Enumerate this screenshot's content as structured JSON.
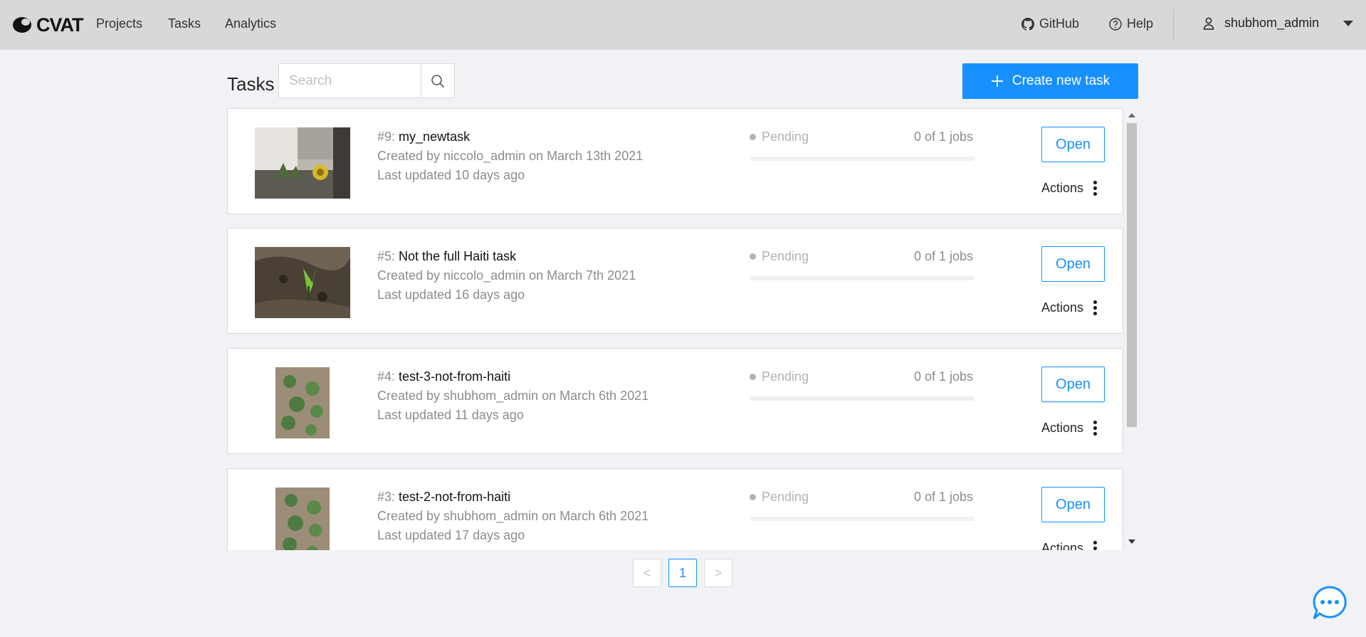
{
  "header": {
    "logo_text": "CVAT",
    "nav": [
      "Projects",
      "Tasks",
      "Analytics"
    ],
    "github_label": "GitHub",
    "help_label": "Help",
    "username": "shubhom_admin"
  },
  "toolbar": {
    "title": "Tasks",
    "search_placeholder": "Search",
    "create_label": "Create new task"
  },
  "tasks": [
    {
      "id": "#9:",
      "name": "my_newtask",
      "created": "Created by niccolo_admin on March 13th 2021",
      "updated": "Last updated 10 days ago",
      "status": "Pending",
      "jobs": "0 of 1 jobs",
      "progress": 0,
      "thumb": "wall-plant-photo",
      "open_label": "Open",
      "actions_label": "Actions"
    },
    {
      "id": "#5:",
      "name": "Not the full Haiti task",
      "created": "Created by niccolo_admin on March 7th 2021",
      "updated": "Last updated 16 days ago",
      "status": "Pending",
      "jobs": "0 of 1 jobs",
      "progress": 0,
      "thumb": "seedling-photo",
      "open_label": "Open",
      "actions_label": "Actions"
    },
    {
      "id": "#4:",
      "name": "test-3-not-from-haiti",
      "created": "Created by shubhom_admin on March 6th 2021",
      "updated": "Last updated 11 days ago",
      "status": "Pending",
      "jobs": "0 of 1 jobs",
      "progress": 0,
      "thumb": "crop-field-photo",
      "open_label": "Open",
      "actions_label": "Actions"
    },
    {
      "id": "#3:",
      "name": "test-2-not-from-haiti",
      "created": "Created by shubhom_admin on March 6th 2021",
      "updated": "Last updated 17 days ago",
      "status": "Pending",
      "jobs": "0 of 1 jobs",
      "progress": 0,
      "thumb": "crop-field-photo",
      "open_label": "Open",
      "actions_label": "Actions"
    }
  ],
  "pagination": {
    "prev": "<",
    "current": "1",
    "next": ">"
  },
  "colors": {
    "accent": "#1890ff",
    "header_bg": "#d8d8d8",
    "page_bg": "#f0f2f5"
  }
}
